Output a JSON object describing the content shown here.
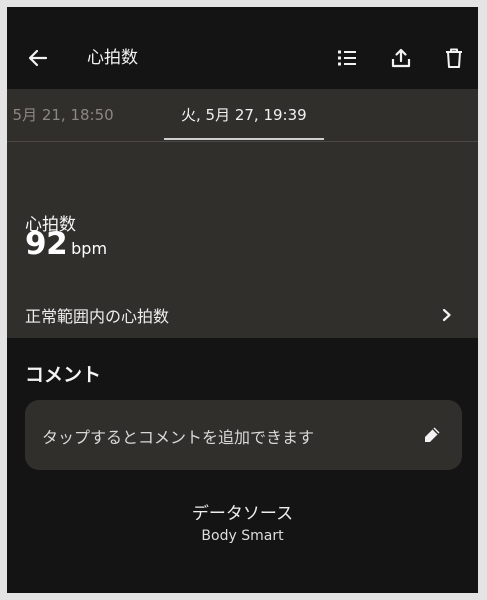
{
  "appbar": {
    "title": "心拍数",
    "back_icon": "back-arrow-icon",
    "actions": [
      "list-icon",
      "share-icon",
      "trash-icon"
    ]
  },
  "tabs": {
    "previous": ", 5月 21, 18:50",
    "current": "火, 5月 27, 19:39"
  },
  "measurement": {
    "label": "心拍数",
    "value": "92",
    "unit": "bpm",
    "range_label": "正常範囲内の心拍数"
  },
  "comment": {
    "title": "コメント",
    "hint": "タップするとコメントを追加できます"
  },
  "datasource": {
    "title": "データソース",
    "value": "Body Smart"
  },
  "colors": {
    "background": "#141414",
    "panel": "#312f2c",
    "text": "#f2f2f2",
    "muted": "#8a8784"
  }
}
